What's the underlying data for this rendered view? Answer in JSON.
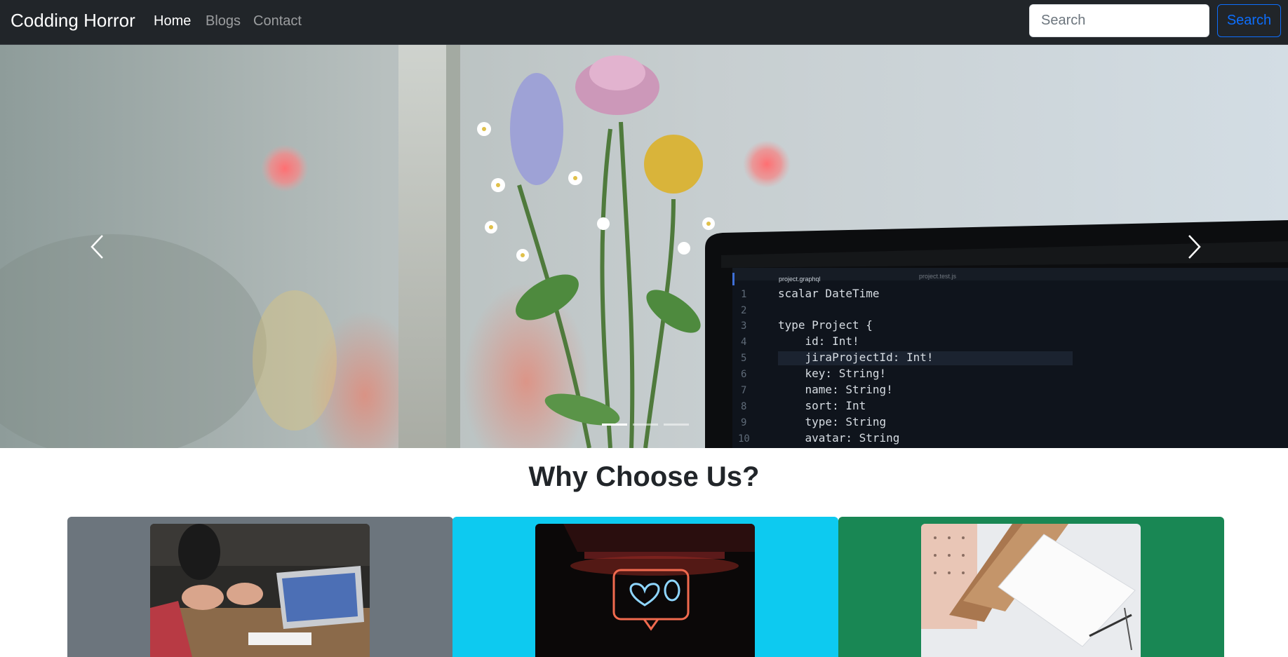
{
  "navbar": {
    "brand": "Codding Horror",
    "links": [
      {
        "label": "Home",
        "active": true
      },
      {
        "label": "Blogs",
        "active": false
      },
      {
        "label": "Contact",
        "active": false
      }
    ],
    "search": {
      "placeholder": "Search",
      "value": "",
      "button_label": "Search"
    }
  },
  "carousel": {
    "slide_count": 3,
    "active_index": 0,
    "prev_icon": "chevron-left-icon",
    "next_icon": "chevron-right-icon",
    "slide_image": "flowers-and-laptop-with-code",
    "editor": {
      "tabs": [
        "project.graphql",
        "project.test.js"
      ],
      "line_numbers": [
        "1",
        "2",
        "3",
        "4",
        "5",
        "6",
        "7",
        "8",
        "9",
        "10"
      ],
      "lines": [
        "scalar DateTime",
        "",
        "type Project {",
        "    id: Int!",
        "    jiraProjectId: Int!",
        "    key: String!",
        "    name: String!",
        "    sort: Int",
        "    type: String",
        "    avatar: String"
      ]
    }
  },
  "section": {
    "title": "Why Choose Us?",
    "cards": [
      {
        "image": "team-meeting-laptop-photo",
        "color": "#6c757d"
      },
      {
        "image": "neon-heart-like-sign-photo",
        "color": "#0dcaf0"
      },
      {
        "image": "notebooks-and-pencil-photo",
        "color": "#198754"
      }
    ]
  },
  "colors": {
    "navbar_bg": "#212529",
    "primary": "#0d6efd",
    "secondary": "#6c757d",
    "info": "#0dcaf0",
    "success": "#198754"
  }
}
